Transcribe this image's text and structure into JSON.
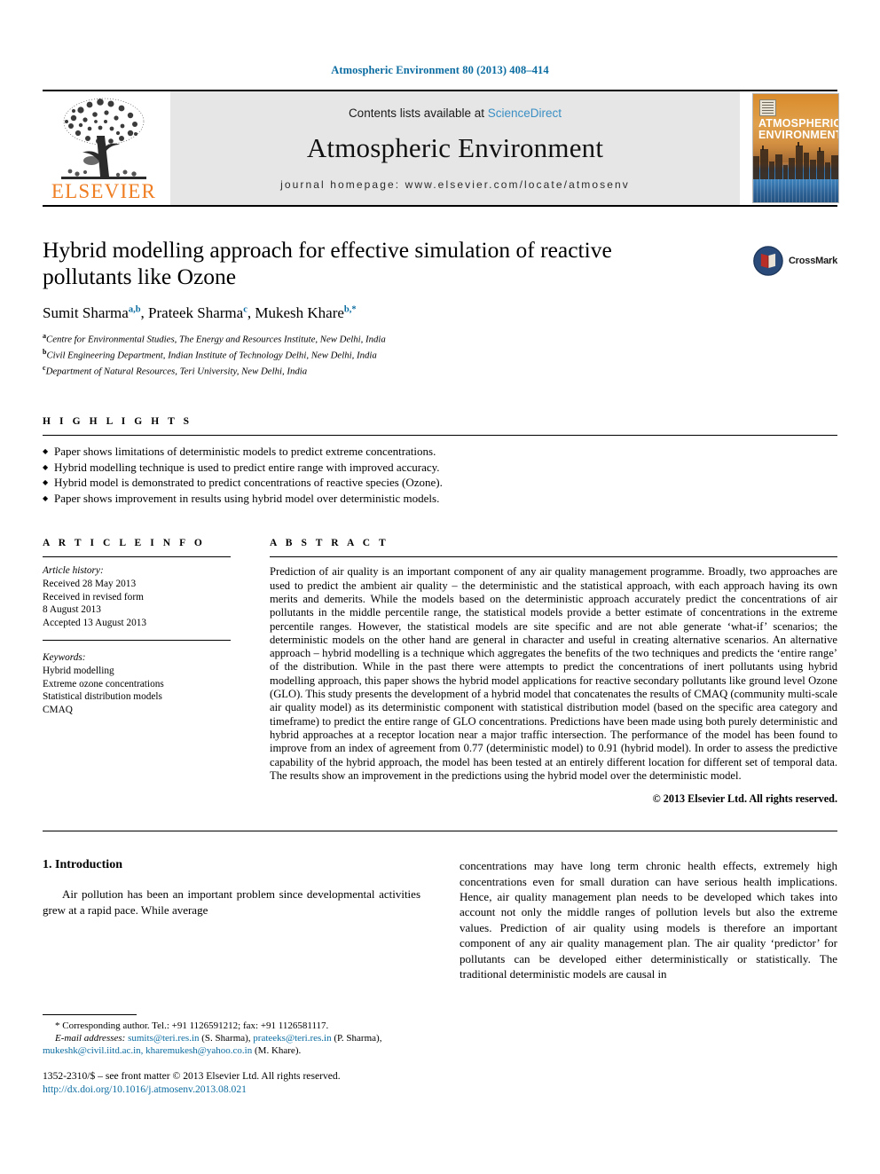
{
  "running_head": "Atmospheric Environment 80 (2013) 408–414",
  "masthead": {
    "publisher": "ELSEVIER",
    "contents_prefix": "Contents lists available at ",
    "contents_link": "ScienceDirect",
    "journal_title": "Atmospheric Environment",
    "homepage": "journal homepage: www.elsevier.com/locate/atmosenv",
    "cover_title_line1": "ATMOSPHERIC",
    "cover_title_line2": "ENVIRONMENT"
  },
  "article": {
    "title": "Hybrid modelling approach for effective simulation of reactive pollutants like Ozone",
    "crossmark_label": "CrossMark",
    "authors": [
      {
        "name": "Sumit Sharma",
        "marks": "a,b",
        "sep": ", "
      },
      {
        "name": "Prateek Sharma",
        "marks": "c",
        "sep": ", "
      },
      {
        "name": "Mukesh Khare",
        "marks": "b,*",
        "sep": ""
      }
    ],
    "affiliations": [
      {
        "mark": "a",
        "text": "Centre for Environmental Studies, The Energy and Resources Institute, New Delhi, India"
      },
      {
        "mark": "b",
        "text": "Civil Engineering Department, Indian Institute of Technology Delhi, New Delhi, India"
      },
      {
        "mark": "c",
        "text": "Department of Natural Resources, Teri University, New Delhi, India"
      }
    ]
  },
  "highlights": {
    "label": "H I G H L I G H T S",
    "items": [
      "Paper shows limitations of deterministic models to predict extreme concentrations.",
      "Hybrid modelling technique is used to predict entire range with improved accuracy.",
      "Hybrid model is demonstrated to predict concentrations of reactive species (Ozone).",
      "Paper shows improvement in results using hybrid model over deterministic models."
    ]
  },
  "article_info": {
    "label": "A R T I C L E   I N F O",
    "history_heading": "Article history:",
    "history_lines": [
      "Received 28 May 2013",
      "Received in revised form",
      "8 August 2013",
      "Accepted 13 August 2013"
    ],
    "keywords_heading": "Keywords:",
    "keywords": [
      "Hybrid modelling",
      "Extreme ozone concentrations",
      "Statistical distribution models",
      "CMAQ"
    ]
  },
  "abstract": {
    "label": "A B S T R A C T",
    "text": "Prediction of air quality is an important component of any air quality management programme. Broadly, two approaches are used to predict the ambient air quality – the deterministic and the statistical approach, with each approach having its own merits and demerits. While the models based on the deterministic approach accurately predict the concentrations of air pollutants in the middle percentile range, the statistical models provide a better estimate of concentrations in the extreme percentile ranges. However, the statistical models are site specific and are not able generate ‘what-if’ scenarios; the deterministic models on the other hand are general in character and useful in creating alternative scenarios. An alternative approach – hybrid modelling is a technique which aggregates the benefits of the two techniques and predicts the ‘entire range’ of the distribution. While in the past there were attempts to predict the concentrations of inert pollutants using hybrid modelling approach, this paper shows the hybrid model applications for reactive secondary pollutants like ground level Ozone (GLO). This study presents the development of a hybrid model that concatenates the results of CMAQ (community multi-scale air quality model) as its deterministic component with statistical distribution model (based on the specific area category and timeframe) to predict the entire range of GLO concentrations. Predictions have been made using both purely deterministic and hybrid approaches at a receptor location near a major traffic intersection. The performance of the model has been found to improve from an index of agreement from 0.77 (deterministic model) to 0.91 (hybrid model). In order to assess the predictive capability of the hybrid approach, the model has been tested at an entirely different location for different set of temporal data. The results show an improvement in the predictions using the hybrid model over the deterministic model.",
    "copyright": "© 2013 Elsevier Ltd. All rights reserved."
  },
  "body": {
    "section_heading": "1. Introduction",
    "left_paragraph": "Air pollution has been an important problem since developmental activities grew at a rapid pace. While average",
    "right_paragraph": "concentrations may have long term chronic health effects, extremely high concentrations even for small duration can have serious health implications. Hence, air quality management plan needs to be developed which takes into account not only the middle ranges of pollution levels but also the extreme values. Prediction of air quality using models is therefore an important component of any air quality management plan. The air quality ‘predictor’ for pollutants can be developed either deterministically or statistically. The traditional deterministic models are causal in"
  },
  "footnote": {
    "corresponding": "* Corresponding author. Tel.: +91 1126591212; fax: +91 1126581117.",
    "email_label": "E-mail addresses:",
    "email_1": "sumits@teri.res.in",
    "email_1_owner": "(S. Sharma),",
    "email_2": "prateeks@teri.res.in",
    "email_2_owner": "(P. Sharma),",
    "email_3": "mukeshk@civil.iitd.ac.in,",
    "email_4": "kharemukesh@yahoo.co.in",
    "email_4_owner": "(M. Khare)."
  },
  "imprint": {
    "line1": "1352-2310/$ – see front matter © 2013 Elsevier Ltd. All rights reserved.",
    "doi": "http://dx.doi.org/10.1016/j.atmosenv.2013.08.021"
  },
  "colors": {
    "link_blue": "#0b6ca1",
    "sciencedirect_blue": "#3a8fc4",
    "elsevier_orange": "#ef7d22",
    "masthead_grey": "#e6e6e6"
  }
}
